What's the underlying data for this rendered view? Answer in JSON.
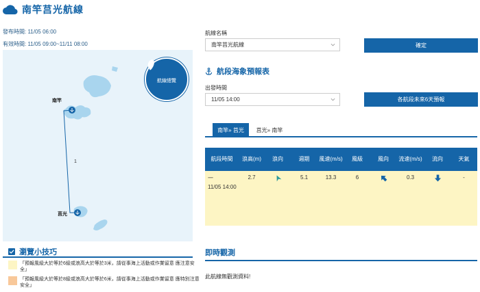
{
  "header": {
    "title": "南竿莒光航線",
    "icon": "cloud-icon"
  },
  "meta": {
    "publish_time": "發布時間: 11/05 06:00",
    "valid_time": "有效時間: 11/05 09:00~11/11 08:00"
  },
  "map": {
    "overview_label": "航線總覽",
    "port_nangan": "南竿",
    "port_juguang": "莒光",
    "segment_number": "1"
  },
  "route_select": {
    "label": "航線名稱",
    "value": "南竿莒光航線",
    "confirm": "確定"
  },
  "forecast_section": {
    "title": "航段海象預報表",
    "icon": "anchor-icon"
  },
  "departure": {
    "label": "出發時間",
    "value": "11/05 14:00",
    "six_day_button": "各航段未來6天預報"
  },
  "tabs": [
    {
      "label": "南竿» 莒光"
    },
    {
      "label": "莒光» 南竿"
    }
  ],
  "table": {
    "headers": [
      "航段時間",
      "浪高(m)",
      "浪向",
      "週期",
      "風速(m/s)",
      "風級",
      "風向",
      "流速(m/s)",
      "流向",
      "天氣"
    ],
    "row": {
      "segment": "一",
      "time": "11/05 14:00",
      "wave_height": "2.7",
      "wave_dir_icon": "wave-direction-arrow-icon",
      "period": "5.1",
      "wind_speed": "13.3",
      "wind_level": "6",
      "wind_dir_icon": "wind-direction-arrow-icon",
      "current_speed": "0.3",
      "current_dir_icon": "current-direction-arrow-icon",
      "weather": "-"
    }
  },
  "tips": {
    "title": "瀏覽小技巧",
    "items": [
      {
        "text": "「預報風級大於等於6級或浪高大於等於3米，請從事海上活動或作業留意 應注意安全」",
        "color": "#fdf5c4"
      },
      {
        "text": "「預報風級大於等於8級或浪高大於等於6米，請從事海上活動或作業留意 應特別注意安全」",
        "color": "#f8c89a"
      }
    ]
  },
  "observation": {
    "title": "即時觀測",
    "text": "此航線無觀測資料!"
  },
  "colors": {
    "primary": "#1565a8",
    "sea": "#e8f3fa",
    "island": "#a9d5ee",
    "highlight_row": "#fdf5c4"
  }
}
